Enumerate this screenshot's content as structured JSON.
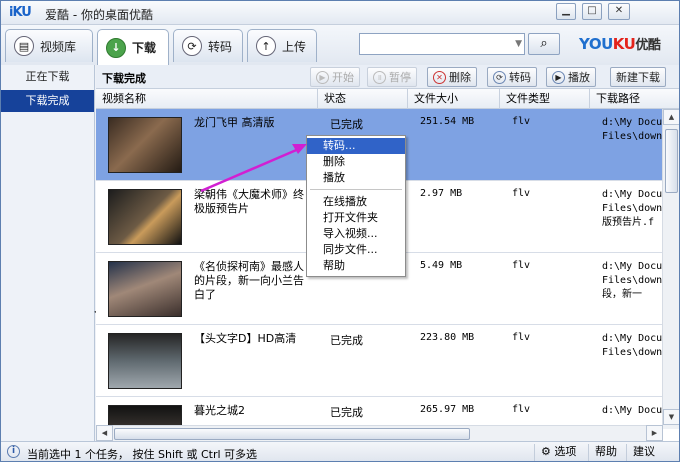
{
  "window": {
    "brand": "iKU",
    "brand_cn": "爱酷",
    "title": "你的桌面优酷"
  },
  "window_controls": [
    "▁",
    "□",
    "✕"
  ],
  "main_tabs": [
    {
      "label": "视频库",
      "icon": "film-icon"
    },
    {
      "label": "下载",
      "icon": "download-icon"
    },
    {
      "label": "转码",
      "icon": "convert-icon"
    },
    {
      "label": "上传",
      "icon": "upload-icon"
    }
  ],
  "search": {
    "value": "",
    "button_icon": "search-icon"
  },
  "youku_logo": {
    "y1": "YOU",
    "y2": "KU",
    "y3": "优酷"
  },
  "sidebar": {
    "items": [
      "正在下载",
      "下载完成"
    ]
  },
  "section_title": "下载完成",
  "actions": {
    "start": "开始",
    "pause": "暂停",
    "delete": "删除",
    "convert": "转码",
    "play": "播放",
    "new_download": "新建下载"
  },
  "columns": [
    "视频名称",
    "状态",
    "文件大小",
    "文件类型",
    "下载路径"
  ],
  "rows": [
    {
      "name": "龙门飞甲 高清版",
      "status": "已完成",
      "size": "251.54 MB",
      "type": "flv",
      "path": "d:\\My Docu\nFiles\\down"
    },
    {
      "name": "梁朝伟《大魔术师》终极版预告片",
      "status": "",
      "size": "2.97 MB",
      "type": "flv",
      "path": "d:\\My Docu\nFiles\\down\n版预告片.f"
    },
    {
      "name": "《名侦探柯南》最感人的片段，新一向小兰告白了",
      "status": "",
      "size": "5.49 MB",
      "type": "flv",
      "path": "d:\\My Docu\nFiles\\down\n段，新一"
    },
    {
      "name": "【头文字D】HD高清",
      "status": "已完成",
      "size": "223.80 MB",
      "type": "flv",
      "path": "d:\\My Docu\nFiles\\down"
    },
    {
      "name": "暮光之城2",
      "status": "已完成",
      "size": "265.97 MB",
      "type": "flv",
      "path": "d:\\My Docu"
    }
  ],
  "context_menu": {
    "group1": [
      "转码...",
      "删除",
      "播放"
    ],
    "group2": [
      "在线播放",
      "打开文件夹",
      "导入视频...",
      "同步文件...",
      "帮助"
    ]
  },
  "statusbar": {
    "text": "当前选中 1 个任务， 按住 Shift 或 Ctrl 可多选",
    "options": "选项",
    "help": "帮助",
    "suggest": "建议"
  },
  "colors": {
    "selected_row": "#7ea2e3",
    "sidebar_active": "#16429a",
    "menu_highlight": "#3063c8",
    "annotation_arrow": "#d21fd2"
  }
}
